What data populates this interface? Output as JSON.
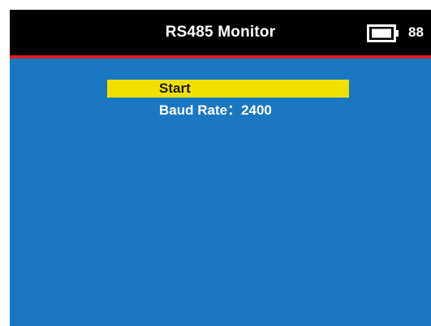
{
  "header": {
    "title": "RS485 Monitor",
    "battery_icon": "battery-icon",
    "battery_level": "88"
  },
  "menu": {
    "items": [
      {
        "label": "Start",
        "selected": true
      },
      {
        "label": "Baud Rate：2400",
        "selected": false
      }
    ]
  },
  "colors": {
    "title_bar": "#000000",
    "accent_line": "#e02020",
    "background": "#1a77c2",
    "highlight": "#f2e000",
    "text": "#ffffff"
  }
}
